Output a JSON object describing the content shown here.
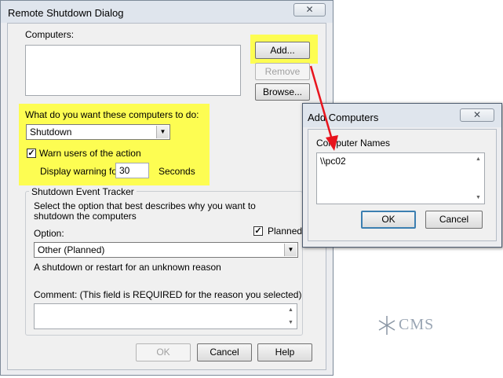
{
  "main_dialog": {
    "title": "Remote Shutdown Dialog",
    "close_glyph": "✕",
    "computers_label": "Computers:",
    "add_label": "Add...",
    "remove_label": "Remove",
    "browse_label": "Browse...",
    "action_prompt": "What do you want these computers to do:",
    "action_value": "Shutdown",
    "warn_checked": true,
    "warn_label": "Warn users of the action",
    "display_warning_label": "Display warning for",
    "warning_seconds": "30",
    "seconds_label": "Seconds",
    "tracker_title": "Shutdown Event Tracker",
    "tracker_desc": "Select the option that best describes why you want to shutdown the computers",
    "option_label": "Option:",
    "planned_checked": true,
    "planned_label": "Planned",
    "option_value": "Other (Planned)",
    "reason_desc": "A shutdown or restart for an unknown reason",
    "comment_label": "Comment: (This field is REQUIRED for the reason you selected)",
    "comment_value": "",
    "ok_label": "OK",
    "cancel_label": "Cancel",
    "help_label": "Help"
  },
  "add_dialog": {
    "title": "Add Computers",
    "close_glyph": "✕",
    "names_label": "Computer Names",
    "names_value": "\\\\pc02",
    "ok_label": "OK",
    "cancel_label": "Cancel"
  },
  "watermark": {
    "text": "CMS"
  },
  "colors": {
    "highlight": "#fdfd52",
    "arrow": "#e8141d",
    "titlebar": "#dfe5ed"
  },
  "icons": {
    "close": "close-icon",
    "dropdown": "chevron-down-icon",
    "scroll_up": "scroll-up-icon",
    "scroll_down": "scroll-down-icon",
    "check": "checkmark-icon"
  }
}
